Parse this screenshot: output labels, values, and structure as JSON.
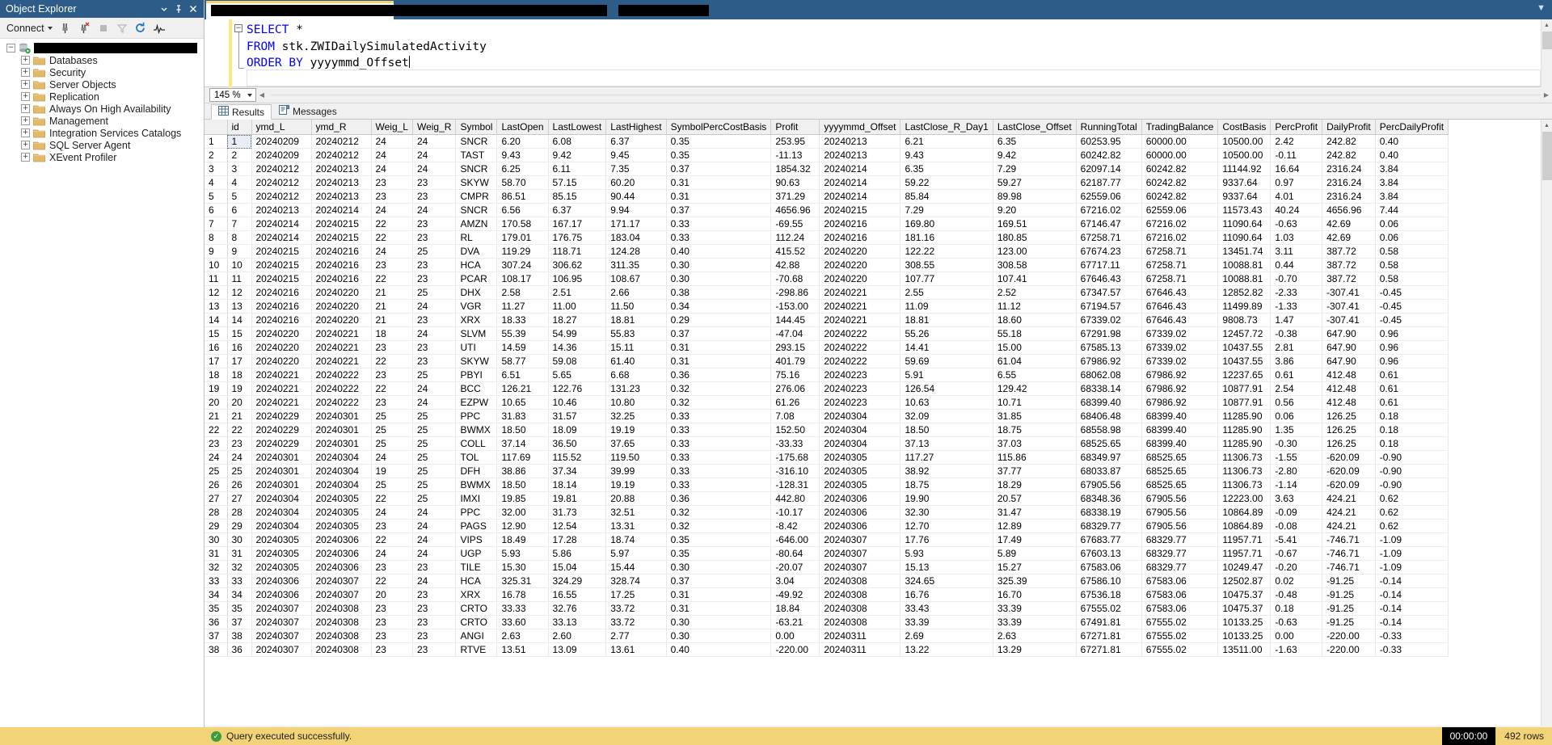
{
  "object_explorer": {
    "title": "Object Explorer",
    "titlebar_icons": [
      "chevron-down-icon",
      "pin-icon",
      "close-icon"
    ],
    "toolbar": {
      "connect_label": "Connect",
      "icons": [
        "connect-server-icon",
        "disconnect-server-icon",
        "stop-icon",
        "filter-icon",
        "refresh-icon",
        "activity-monitor-icon"
      ]
    },
    "root": {
      "label": "",
      "redacted": true
    },
    "items": [
      {
        "label": "Databases"
      },
      {
        "label": "Security"
      },
      {
        "label": "Server Objects"
      },
      {
        "label": "Replication"
      },
      {
        "label": "Always On High Availability"
      },
      {
        "label": "Management"
      },
      {
        "label": "Integration Services Catalogs"
      },
      {
        "label": "SQL Server Agent"
      },
      {
        "label": "XEvent Profiler"
      }
    ]
  },
  "editor": {
    "tab_redacted": true,
    "zoom": "145 %",
    "lines": [
      {
        "fold": true,
        "parts": [
          {
            "t": "SELECT",
            "kw": true
          },
          {
            "t": " *",
            "kw": false
          }
        ]
      },
      {
        "fold": false,
        "parts": [
          {
            "t": "FROM",
            "kw": true
          },
          {
            "t": " stk.ZWIDailySimulatedActivity",
            "kw": false
          }
        ]
      },
      {
        "fold": false,
        "parts": [
          {
            "t": "ORDER BY",
            "kw": true
          },
          {
            "t": " yyyymmd_Offset",
            "kw": false
          }
        ],
        "cursor": true
      }
    ]
  },
  "results_panel": {
    "tabs": [
      {
        "label": "Results",
        "icon": "grid-icon",
        "selected": true
      },
      {
        "label": "Messages",
        "icon": "message-icon",
        "selected": false
      }
    ]
  },
  "grid": {
    "columns": [
      "id",
      "ymd_L",
      "ymd_R",
      "Weig_L",
      "Weig_R",
      "Symbol",
      "LastOpen",
      "LastLowest",
      "LastHighest",
      "SymbolPercCostBasis",
      "Profit",
      "yyyymmd_Offset",
      "LastClose_R_Day1",
      "LastClose_Offset",
      "RunningTotal",
      "TradingBalance",
      "CostBasis",
      "PercProfit",
      "DailyProfit",
      "PercDailyProfit"
    ],
    "selected_cell": {
      "row": 0,
      "col": 0
    },
    "rows": [
      [
        "1",
        "1",
        "20240209",
        "20240212",
        "24",
        "24",
        "SNCR",
        "6.20",
        "6.08",
        "6.37",
        "0.35",
        "253.95",
        "20240213",
        "6.21",
        "6.35",
        "60253.95",
        "60000.00",
        "10500.00",
        "2.42",
        "242.82",
        "0.40"
      ],
      [
        "2",
        "2",
        "20240209",
        "20240212",
        "24",
        "24",
        "TAST",
        "9.43",
        "9.42",
        "9.45",
        "0.35",
        "-11.13",
        "20240213",
        "9.43",
        "9.42",
        "60242.82",
        "60000.00",
        "10500.00",
        "-0.11",
        "242.82",
        "0.40"
      ],
      [
        "3",
        "3",
        "20240212",
        "20240213",
        "24",
        "24",
        "SNCR",
        "6.25",
        "6.11",
        "7.35",
        "0.37",
        "1854.32",
        "20240214",
        "6.35",
        "7.29",
        "62097.14",
        "60242.82",
        "11144.92",
        "16.64",
        "2316.24",
        "3.84"
      ],
      [
        "4",
        "4",
        "20240212",
        "20240213",
        "23",
        "23",
        "SKYW",
        "58.70",
        "57.15",
        "60.20",
        "0.31",
        "90.63",
        "20240214",
        "59.22",
        "59.27",
        "62187.77",
        "60242.82",
        "9337.64",
        "0.97",
        "2316.24",
        "3.84"
      ],
      [
        "5",
        "5",
        "20240212",
        "20240213",
        "23",
        "23",
        "CMPR",
        "86.51",
        "85.15",
        "90.44",
        "0.31",
        "371.29",
        "20240214",
        "85.84",
        "89.98",
        "62559.06",
        "60242.82",
        "9337.64",
        "4.01",
        "2316.24",
        "3.84"
      ],
      [
        "6",
        "6",
        "20240213",
        "20240214",
        "24",
        "24",
        "SNCR",
        "6.56",
        "6.37",
        "9.94",
        "0.37",
        "4656.96",
        "20240215",
        "7.29",
        "9.20",
        "67216.02",
        "62559.06",
        "11573.43",
        "40.24",
        "4656.96",
        "7.44"
      ],
      [
        "7",
        "7",
        "20240214",
        "20240215",
        "22",
        "23",
        "AMZN",
        "170.58",
        "167.17",
        "171.17",
        "0.33",
        "-69.55",
        "20240216",
        "169.80",
        "169.51",
        "67146.47",
        "67216.02",
        "11090.64",
        "-0.63",
        "42.69",
        "0.06"
      ],
      [
        "8",
        "8",
        "20240214",
        "20240215",
        "22",
        "23",
        "RL",
        "179.01",
        "176.75",
        "183.04",
        "0.33",
        "112.24",
        "20240216",
        "181.16",
        "180.85",
        "67258.71",
        "67216.02",
        "11090.64",
        "1.03",
        "42.69",
        "0.06"
      ],
      [
        "9",
        "9",
        "20240215",
        "20240216",
        "24",
        "25",
        "DVA",
        "119.29",
        "118.71",
        "124.28",
        "0.40",
        "415.52",
        "20240220",
        "122.22",
        "123.00",
        "67674.23",
        "67258.71",
        "13451.74",
        "3.11",
        "387.72",
        "0.58"
      ],
      [
        "10",
        "10",
        "20240215",
        "20240216",
        "23",
        "23",
        "HCA",
        "307.24",
        "306.62",
        "311.35",
        "0.30",
        "42.88",
        "20240220",
        "308.55",
        "308.58",
        "67717.11",
        "67258.71",
        "10088.81",
        "0.44",
        "387.72",
        "0.58"
      ],
      [
        "11",
        "11",
        "20240215",
        "20240216",
        "22",
        "23",
        "PCAR",
        "108.17",
        "106.95",
        "108.67",
        "0.30",
        "-70.68",
        "20240220",
        "107.77",
        "107.41",
        "67646.43",
        "67258.71",
        "10088.81",
        "-0.70",
        "387.72",
        "0.58"
      ],
      [
        "12",
        "12",
        "20240216",
        "20240220",
        "21",
        "25",
        "DHX",
        "2.58",
        "2.51",
        "2.66",
        "0.38",
        "-298.86",
        "20240221",
        "2.55",
        "2.52",
        "67347.57",
        "67646.43",
        "12852.82",
        "-2.33",
        "-307.41",
        "-0.45"
      ],
      [
        "13",
        "13",
        "20240216",
        "20240220",
        "21",
        "24",
        "VGR",
        "11.27",
        "11.00",
        "11.50",
        "0.34",
        "-153.00",
        "20240221",
        "11.09",
        "11.12",
        "67194.57",
        "67646.43",
        "11499.89",
        "-1.33",
        "-307.41",
        "-0.45"
      ],
      [
        "14",
        "14",
        "20240216",
        "20240220",
        "21",
        "23",
        "XRX",
        "18.33",
        "18.27",
        "18.81",
        "0.29",
        "144.45",
        "20240221",
        "18.81",
        "18.60",
        "67339.02",
        "67646.43",
        "9808.73",
        "1.47",
        "-307.41",
        "-0.45"
      ],
      [
        "15",
        "15",
        "20240220",
        "20240221",
        "18",
        "24",
        "SLVM",
        "55.39",
        "54.99",
        "55.83",
        "0.37",
        "-47.04",
        "20240222",
        "55.26",
        "55.18",
        "67291.98",
        "67339.02",
        "12457.72",
        "-0.38",
        "647.90",
        "0.96"
      ],
      [
        "16",
        "16",
        "20240220",
        "20240221",
        "23",
        "23",
        "UTI",
        "14.59",
        "14.36",
        "15.11",
        "0.31",
        "293.15",
        "20240222",
        "14.41",
        "15.00",
        "67585.13",
        "67339.02",
        "10437.55",
        "2.81",
        "647.90",
        "0.96"
      ],
      [
        "17",
        "17",
        "20240220",
        "20240221",
        "22",
        "23",
        "SKYW",
        "58.77",
        "59.08",
        "61.40",
        "0.31",
        "401.79",
        "20240222",
        "59.69",
        "61.04",
        "67986.92",
        "67339.02",
        "10437.55",
        "3.86",
        "647.90",
        "0.96"
      ],
      [
        "18",
        "18",
        "20240221",
        "20240222",
        "23",
        "25",
        "PBYI",
        "6.51",
        "5.65",
        "6.68",
        "0.36",
        "75.16",
        "20240223",
        "5.91",
        "6.55",
        "68062.08",
        "67986.92",
        "12237.65",
        "0.61",
        "412.48",
        "0.61"
      ],
      [
        "19",
        "19",
        "20240221",
        "20240222",
        "22",
        "24",
        "BCC",
        "126.21",
        "122.76",
        "131.23",
        "0.32",
        "276.06",
        "20240223",
        "126.54",
        "129.42",
        "68338.14",
        "67986.92",
        "10877.91",
        "2.54",
        "412.48",
        "0.61"
      ],
      [
        "20",
        "20",
        "20240221",
        "20240222",
        "23",
        "24",
        "EZPW",
        "10.65",
        "10.46",
        "10.80",
        "0.32",
        "61.26",
        "20240223",
        "10.63",
        "10.71",
        "68399.40",
        "67986.92",
        "10877.91",
        "0.56",
        "412.48",
        "0.61"
      ],
      [
        "21",
        "21",
        "20240229",
        "20240301",
        "25",
        "25",
        "PPC",
        "31.83",
        "31.57",
        "32.25",
        "0.33",
        "7.08",
        "20240304",
        "32.09",
        "31.85",
        "68406.48",
        "68399.40",
        "11285.90",
        "0.06",
        "126.25",
        "0.18"
      ],
      [
        "22",
        "22",
        "20240229",
        "20240301",
        "25",
        "25",
        "BWMX",
        "18.50",
        "18.09",
        "19.19",
        "0.33",
        "152.50",
        "20240304",
        "18.50",
        "18.75",
        "68558.98",
        "68399.40",
        "11285.90",
        "1.35",
        "126.25",
        "0.18"
      ],
      [
        "23",
        "23",
        "20240229",
        "20240301",
        "25",
        "25",
        "COLL",
        "37.14",
        "36.50",
        "37.65",
        "0.33",
        "-33.33",
        "20240304",
        "37.13",
        "37.03",
        "68525.65",
        "68399.40",
        "11285.90",
        "-0.30",
        "126.25",
        "0.18"
      ],
      [
        "24",
        "24",
        "20240301",
        "20240304",
        "24",
        "25",
        "TOL",
        "117.69",
        "115.52",
        "119.50",
        "0.33",
        "-175.68",
        "20240305",
        "117.27",
        "115.86",
        "68349.97",
        "68525.65",
        "11306.73",
        "-1.55",
        "-620.09",
        "-0.90"
      ],
      [
        "25",
        "25",
        "20240301",
        "20240304",
        "19",
        "25",
        "DFH",
        "38.86",
        "37.34",
        "39.99",
        "0.33",
        "-316.10",
        "20240305",
        "38.92",
        "37.77",
        "68033.87",
        "68525.65",
        "11306.73",
        "-2.80",
        "-620.09",
        "-0.90"
      ],
      [
        "26",
        "26",
        "20240301",
        "20240304",
        "25",
        "25",
        "BWMX",
        "18.50",
        "18.14",
        "19.19",
        "0.33",
        "-128.31",
        "20240305",
        "18.75",
        "18.29",
        "67905.56",
        "68525.65",
        "11306.73",
        "-1.14",
        "-620.09",
        "-0.90"
      ],
      [
        "27",
        "27",
        "20240304",
        "20240305",
        "22",
        "25",
        "IMXI",
        "19.85",
        "19.81",
        "20.88",
        "0.36",
        "442.80",
        "20240306",
        "19.90",
        "20.57",
        "68348.36",
        "67905.56",
        "12223.00",
        "3.63",
        "424.21",
        "0.62"
      ],
      [
        "28",
        "28",
        "20240304",
        "20240305",
        "24",
        "24",
        "PPC",
        "32.00",
        "31.73",
        "32.51",
        "0.32",
        "-10.17",
        "20240306",
        "32.30",
        "31.47",
        "68338.19",
        "67905.56",
        "10864.89",
        "-0.09",
        "424.21",
        "0.62"
      ],
      [
        "29",
        "29",
        "20240304",
        "20240305",
        "23",
        "24",
        "PAGS",
        "12.90",
        "12.54",
        "13.31",
        "0.32",
        "-8.42",
        "20240306",
        "12.70",
        "12.89",
        "68329.77",
        "67905.56",
        "10864.89",
        "-0.08",
        "424.21",
        "0.62"
      ],
      [
        "30",
        "30",
        "20240305",
        "20240306",
        "22",
        "24",
        "VIPS",
        "18.49",
        "17.28",
        "18.74",
        "0.35",
        "-646.00",
        "20240307",
        "17.76",
        "17.49",
        "67683.77",
        "68329.77",
        "11957.71",
        "-5.41",
        "-746.71",
        "-1.09"
      ],
      [
        "31",
        "31",
        "20240305",
        "20240306",
        "24",
        "24",
        "UGP",
        "5.93",
        "5.86",
        "5.97",
        "0.35",
        "-80.64",
        "20240307",
        "5.93",
        "5.89",
        "67603.13",
        "68329.77",
        "11957.71",
        "-0.67",
        "-746.71",
        "-1.09"
      ],
      [
        "32",
        "32",
        "20240305",
        "20240306",
        "23",
        "23",
        "TILE",
        "15.30",
        "15.04",
        "15.44",
        "0.30",
        "-20.07",
        "20240307",
        "15.13",
        "15.27",
        "67583.06",
        "68329.77",
        "10249.47",
        "-0.20",
        "-746.71",
        "-1.09"
      ],
      [
        "33",
        "33",
        "20240306",
        "20240307",
        "22",
        "24",
        "HCA",
        "325.31",
        "324.29",
        "328.74",
        "0.37",
        "3.04",
        "20240308",
        "324.65",
        "325.39",
        "67586.10",
        "67583.06",
        "12502.87",
        "0.02",
        "-91.25",
        "-0.14"
      ],
      [
        "34",
        "34",
        "20240306",
        "20240307",
        "20",
        "23",
        "XRX",
        "16.78",
        "16.55",
        "17.25",
        "0.31",
        "-49.92",
        "20240308",
        "16.76",
        "16.70",
        "67536.18",
        "67583.06",
        "10475.37",
        "-0.48",
        "-91.25",
        "-0.14"
      ],
      [
        "35",
        "35",
        "20240307",
        "20240308",
        "23",
        "23",
        "CRTO",
        "33.33",
        "32.76",
        "33.72",
        "0.31",
        "18.84",
        "20240308",
        "33.43",
        "33.39",
        "67555.02",
        "67583.06",
        "10475.37",
        "0.18",
        "-91.25",
        "-0.14"
      ],
      [
        "36",
        "37",
        "20240307",
        "20240308",
        "23",
        "23",
        "CRTO",
        "33.60",
        "33.13",
        "33.72",
        "0.30",
        "-63.21",
        "20240308",
        "33.39",
        "33.39",
        "67491.81",
        "67555.02",
        "10133.25",
        "-0.63",
        "-91.25",
        "-0.14"
      ],
      [
        "37",
        "38",
        "20240307",
        "20240308",
        "23",
        "23",
        "ANGI",
        "2.63",
        "2.60",
        "2.77",
        "0.30",
        "0.00",
        "20240311",
        "2.69",
        "2.63",
        "67271.81",
        "67555.02",
        "10133.25",
        "0.00",
        "-220.00",
        "-0.33"
      ],
      [
        "38",
        "36",
        "20240307",
        "20240308",
        "23",
        "23",
        "RTVE",
        "13.51",
        "13.09",
        "13.61",
        "0.40",
        "-220.00",
        "20240311",
        "13.22",
        "13.29",
        "67271.81",
        "67555.02",
        "13511.00",
        "-1.63",
        "-220.00",
        "-0.33"
      ]
    ]
  },
  "statusbar": {
    "message": "Query executed successfully.",
    "elapsed": "00:00:00",
    "rows": "492 rows"
  }
}
